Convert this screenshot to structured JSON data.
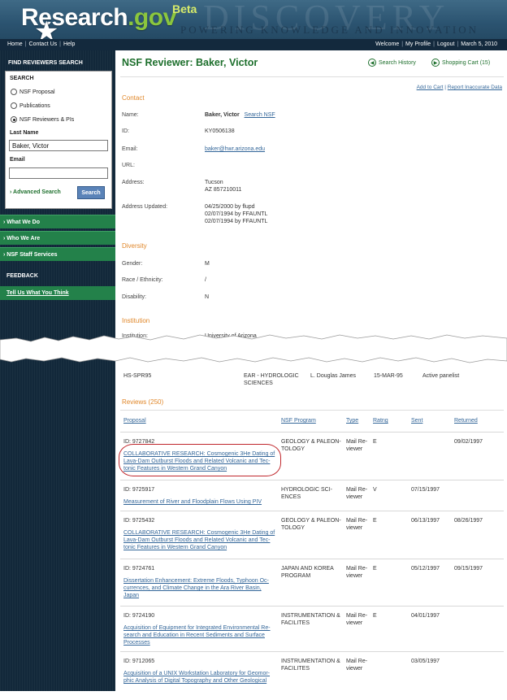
{
  "header": {
    "logo_main": "Research",
    "logo_dot": ".gov",
    "beta": "Beta",
    "bg_word": "DISCOVERY",
    "tagline": "POWERING KNOWLEDGE AND INNOVATION"
  },
  "nav": {
    "home": "Home",
    "contact": "Contact Us",
    "help": "Help",
    "welcome": "Welcome",
    "profile": "My Profile",
    "logout": "Logout",
    "date": "March 5, 2010"
  },
  "sidebar": {
    "find_title": "FIND REVIEWERS SEARCH",
    "search_label": "SEARCH",
    "radios": [
      "NSF Proposal",
      "Publications",
      "NSF Reviewers & PIs"
    ],
    "last_name_label": "Last Name",
    "last_name_value": "Baker, Victor",
    "email_label": "Email",
    "email_value": "",
    "advanced": "Advanced Search",
    "search_button": "Search",
    "nav_items": [
      "What We Do",
      "Who We Are",
      "NSF Staff Services"
    ],
    "feedback_title": "FEEDBACK",
    "feedback_link": "Tell Us What You Think"
  },
  "main": {
    "title": "NSF Reviewer: Baker, Victor",
    "search_history": "Search History",
    "shopping_cart": "Shopping Cart (15)",
    "add_to_cart": "Add to Cart",
    "report": "Report Inaccurate Data",
    "contact": {
      "heading": "Contact",
      "name_label": "Name:",
      "name_value": "Baker, Victor",
      "search_nsf": "Search NSF",
      "id_label": "ID:",
      "id_value": "KY0506138",
      "email_label": "Email:",
      "email_value": "baker@hwr.arizona.edu",
      "url_label": "URL:",
      "address_label": "Address:",
      "address_line1": "Tucson",
      "address_line2": "AZ 857210011",
      "updated_label": "Address Updated:",
      "updated_lines": [
        "04/25/2000 by flupd",
        "02/07/1994 by FFAUNTL",
        "02/07/1994 by FFAUNTL"
      ]
    },
    "diversity": {
      "heading": "Diversity",
      "gender_label": "Gender:",
      "gender_value": "M",
      "race_label": "Race / Ethnicity:",
      "race_value": "/",
      "disability_label": "Disability:",
      "disability_value": "N"
    },
    "institution": {
      "heading": "Institution",
      "inst_label": "Institution:",
      "inst_value": "University of Arizona"
    },
    "panel_row": {
      "c1": "HS-SPR95",
      "c2a": "EAR - HYDROLOGIC",
      "c2b": "SCIENCES",
      "c3": "L. Douglas James",
      "c4": "15-MAR-95",
      "c5": "Active panelist"
    },
    "reviews": {
      "heading": "Reviews (250)",
      "headers": [
        "Proposal",
        "NSF Program",
        "Type",
        "Ratng",
        "Sent",
        "Returned"
      ],
      "rows": [
        {
          "id": "ID: 9727842",
          "t1": "COLLABORATIVE RESEARCH: Cosmogenic 3He Dating of",
          "t2": "Lava-Dam Outburst Floods and Related Volcanic and Tec-",
          "t3": "tonic Features in Western Grand Canyon",
          "t4": "",
          "p1": "GEOLOGY & PALEON-",
          "p2": "TOLOGY",
          "ty1": "Mail Re-",
          "ty2": "viewer",
          "rating": "E",
          "sent": "",
          "returned": "09/02/1997"
        },
        {
          "id": "ID: 9725917",
          "t1": "Measurement of River and Floodplain Flows Using PIV",
          "t2": "",
          "t3": "",
          "t4": "",
          "p1": "HYDROLOGIC SCI-",
          "p2": "ENCES",
          "ty1": "Mail Re-",
          "ty2": "viewer",
          "rating": "V",
          "sent": "07/15/1997",
          "returned": ""
        },
        {
          "id": "ID: 9725432",
          "t1": "COLLABORATIVE RESEARCH: Cosmogenic 3He Dating of",
          "t2": "Lava-Dam Outburst Floods and Related Volcanic and Tec-",
          "t3": "tonic Features in Western Grand Canyon",
          "t4": "",
          "p1": "GEOLOGY & PALEON-",
          "p2": "TOLOGY",
          "ty1": "Mail Re-",
          "ty2": "viewer",
          "rating": "E",
          "sent": "06/13/1997",
          "returned": "08/26/1997"
        },
        {
          "id": "ID: 9724761",
          "t1": "Dissertation Enhancement: Extreme Floods, Typhoon Oc-",
          "t2": "currences, and Climate Change in the Ara River Basin,",
          "t3": "Japan",
          "t4": "",
          "p1": "JAPAN AND KOREA",
          "p2": "PROGRAM",
          "ty1": "Mail Re-",
          "ty2": "viewer",
          "rating": "E",
          "sent": "05/12/1997",
          "returned": "09/15/1997"
        },
        {
          "id": "ID: 9724190",
          "t1": "Acquisition of Equipment for Integrated Environmental Re-",
          "t2": "search and Education in Recent Sediments and Surface",
          "t3": "Processes",
          "t4": "",
          "p1": "INSTRUMENTATION &",
          "p2": "FACILITES",
          "ty1": "Mail Re-",
          "ty2": "viewer",
          "rating": "E",
          "sent": "04/01/1997",
          "returned": ""
        },
        {
          "id": "ID: 9712065",
          "t1": "Acquisition of a UNIX Workstation Laboratory for Geomor-",
          "t2": "phic Analysis of Digital Topography and Other Geological",
          "t3": "",
          "t4": "",
          "p1": "INSTRUMENTATION &",
          "p2": "FACILITES",
          "ty1": "Mail Re-",
          "ty2": "viewer",
          "rating": "",
          "sent": "03/05/1997",
          "returned": ""
        }
      ]
    }
  },
  "colors": {
    "accent_green": "#1d6f2c",
    "section_orange": "#e0872a",
    "link_blue": "#336699",
    "sidebar_navy": "#12283a",
    "menu_green": "#23814a",
    "highlight_red": "#c0282d"
  }
}
